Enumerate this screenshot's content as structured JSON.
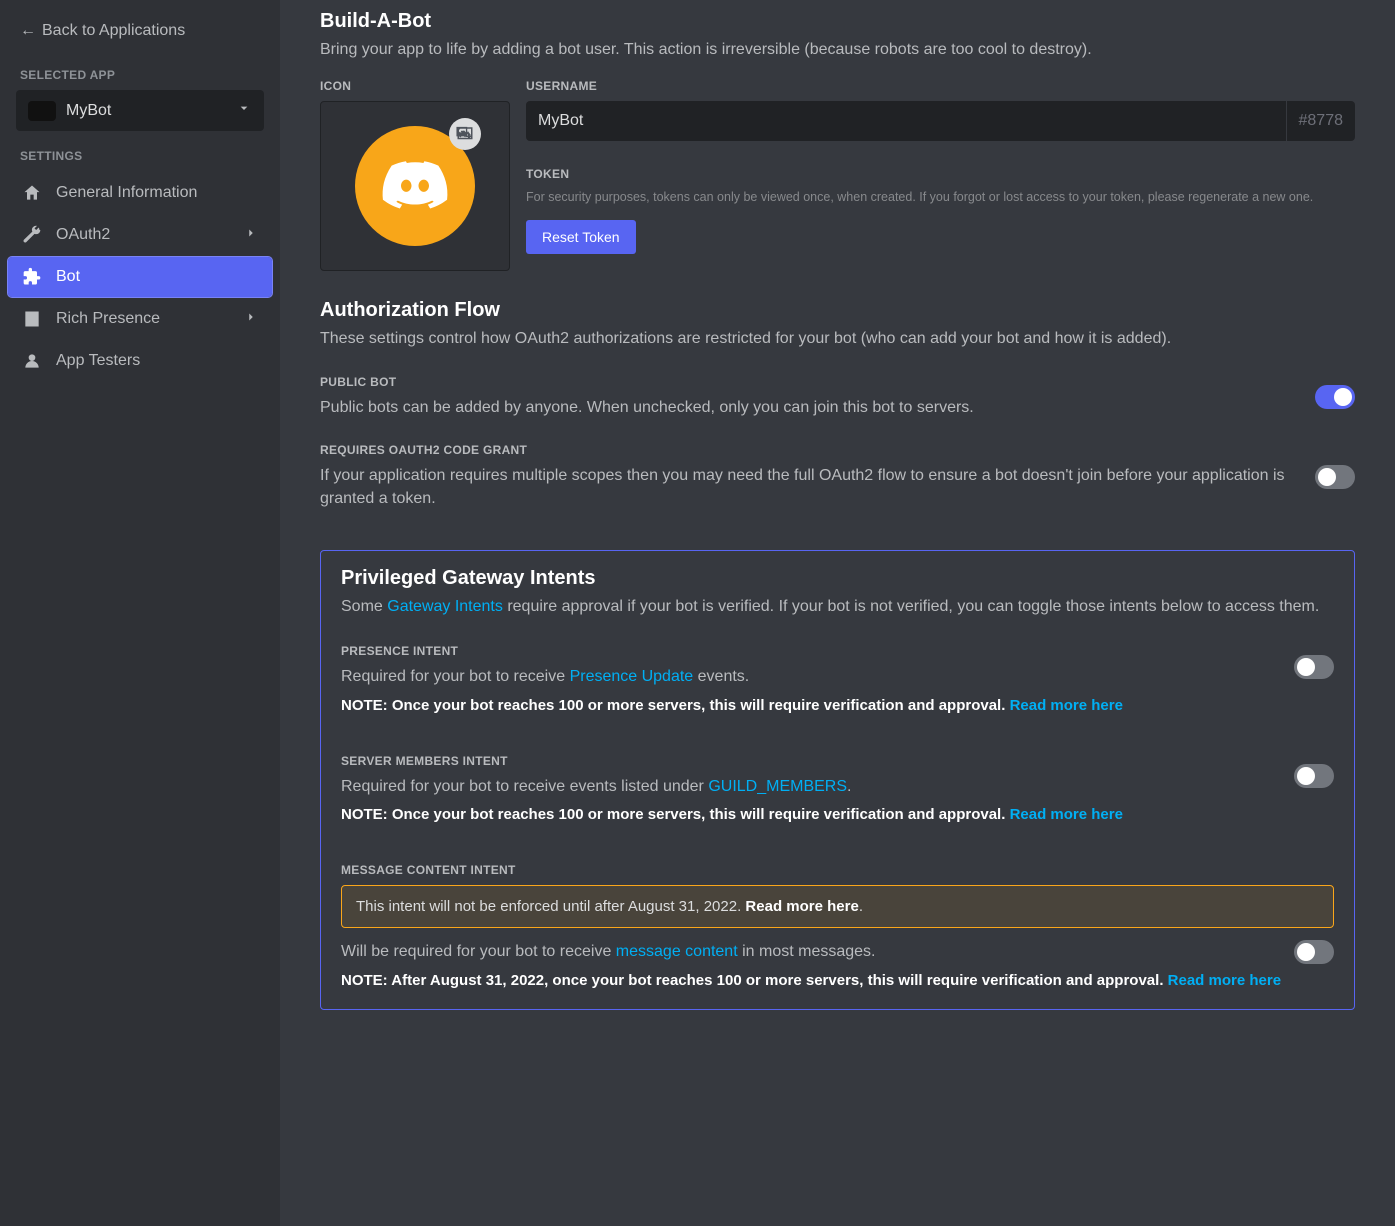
{
  "sidebar": {
    "back": "Back to Applications",
    "selected_app_header": "Selected App",
    "selected_app_name": "MyBot",
    "settings_header": "Settings",
    "items": {
      "general": "General Information",
      "oauth2": "OAuth2",
      "bot": "Bot",
      "rich": "Rich Presence",
      "testers": "App Testers"
    }
  },
  "build": {
    "title": "Build-A-Bot",
    "subtitle": "Bring your app to life by adding a bot user. This action is irreversible (because robots are too cool to destroy).",
    "icon_label": "Icon",
    "username_label": "Username",
    "username_value": "MyBot",
    "discriminator": "#8778",
    "token_label": "Token",
    "token_note": "For security purposes, tokens can only be viewed once, when created. If you forgot or lost access to your token, please regenerate a new one.",
    "reset_token": "Reset Token"
  },
  "auth": {
    "title": "Authorization Flow",
    "subtitle": "These settings control how OAuth2 authorizations are restricted for your bot (who can add your bot and how it is added).",
    "public_bot_header": "Public Bot",
    "public_bot_desc": "Public bots can be added by anyone. When unchecked, only you can join this bot to servers.",
    "oauth_grant_header": "Requires OAuth2 Code Grant",
    "oauth_grant_desc": "If your application requires multiple scopes then you may need the full OAuth2 flow to ensure a bot doesn't join before your application is granted a token."
  },
  "intents": {
    "title": "Privileged Gateway Intents",
    "subtitle_pre": "Some ",
    "subtitle_link": "Gateway Intents",
    "subtitle_post": " require approval if your bot is verified. If your bot is not verified, you can toggle those intents below to access them.",
    "presence_header": "Presence Intent",
    "presence_desc_pre": "Required for your bot to receive ",
    "presence_link": "Presence Update",
    "presence_desc_post": " events.",
    "note100": "NOTE: Once your bot reaches 100 or more servers, this will require verification and approval. ",
    "read_more": "Read more here",
    "members_header": "Server Members Intent",
    "members_desc_pre": "Required for your bot to receive events listed under ",
    "members_link": "GUILD_MEMBERS",
    "members_desc_post": ".",
    "message_header": "Message Content Intent",
    "message_banner_pre": "This intent will not be enforced until after August 31, 2022. ",
    "message_banner_link": "Read more here",
    "message_banner_post": ".",
    "message_desc_pre": "Will be required for your bot to receive ",
    "message_link": "message content",
    "message_desc_post": " in most messages.",
    "note_after": "NOTE: After August 31, 2022, once your bot reaches 100 or more servers, this will require verification and approval. "
  }
}
